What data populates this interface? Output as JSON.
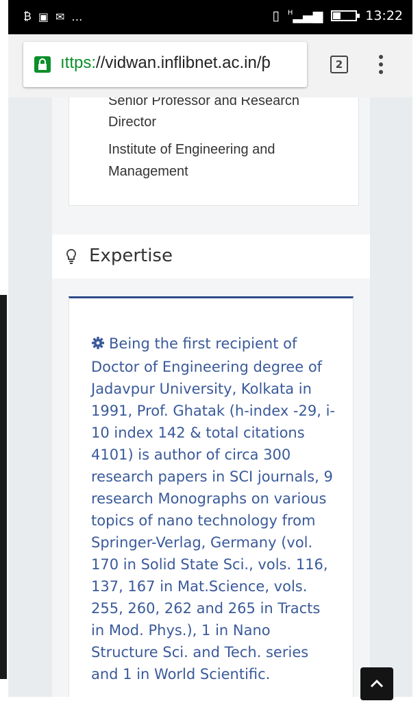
{
  "status_bar": {
    "left_icons": [
      "data-icon",
      "image-icon",
      "mail-icon",
      "more-icon"
    ],
    "right_icons": [
      "vibrate-icon",
      "signal-icon",
      "battery-icon"
    ],
    "signal_text": "H",
    "time": "13:22",
    "battery_level": 0.35
  },
  "browser": {
    "url_scheme": "ıttps:",
    "url_rest": "//vidwan.inflibnet.ac.in/ƥ",
    "tab_count": "2",
    "accent_color": "#0b8f2a"
  },
  "affiliation": {
    "line1": "Senior Professor and Research",
    "line2": "Director",
    "line3": "Institute of Engineering and",
    "line4": "Management"
  },
  "expertise": {
    "title": "Expertise",
    "text": "Being the first recipient of Doctor of Engineering degree of Jadavpur University, Kolkata in 1991, Prof. Ghatak (h-index -29, i-10 index 142 & total citations 4101) is author of circa 300 research papers in SCI journals, 9 research Monographs on various topics of nano technology from Springer-Verlag, Germany (vol. 170 in Solid State Sci., vols. 116, 137, 167 in Mat.Science, vols. 255, 260, 262 and 265 in Tracts in Mod. Phys.), 1 in Nano Structure Sci. and Tech. series and 1 in World Scientific.",
    "accent_color": "#2e4a87",
    "text_color": "#3a5a9a"
  }
}
